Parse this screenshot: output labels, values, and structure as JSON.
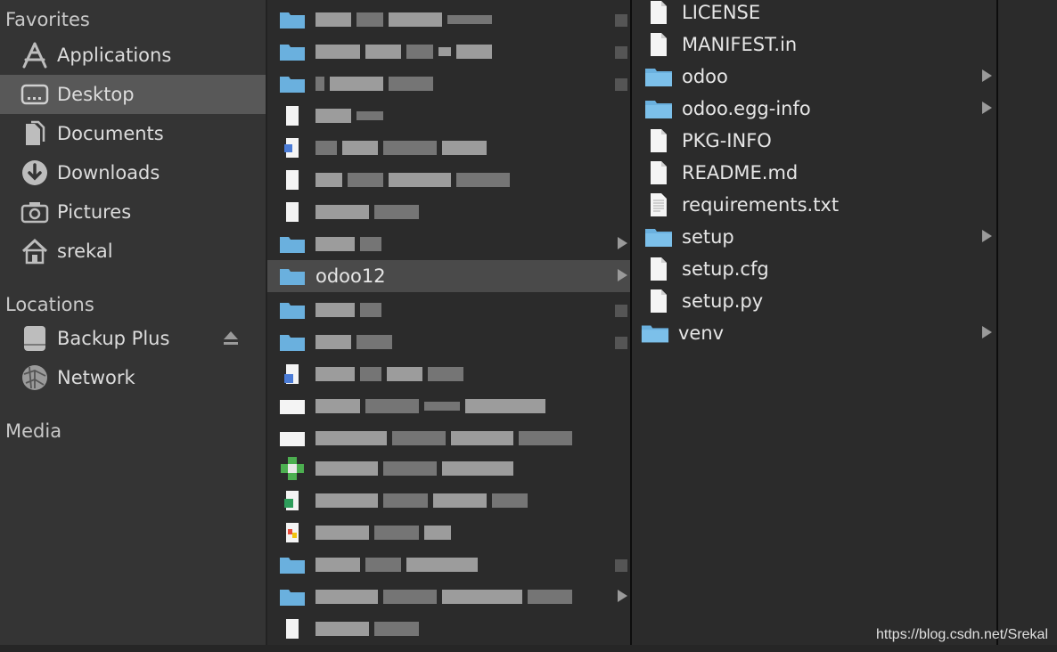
{
  "sidebar": {
    "favorites_title": "Favorites",
    "locations_title": "Locations",
    "media_title": "Media",
    "favorites": [
      {
        "label": "Applications",
        "icon": "applications-icon"
      },
      {
        "label": "Desktop",
        "icon": "desktop-icon"
      },
      {
        "label": "Documents",
        "icon": "documents-icon"
      },
      {
        "label": "Downloads",
        "icon": "downloads-icon"
      },
      {
        "label": "Pictures",
        "icon": "pictures-icon"
      },
      {
        "label": "srekal",
        "icon": "home-icon"
      }
    ],
    "locations": [
      {
        "label": "Backup Plus",
        "icon": "drive-icon"
      },
      {
        "label": "Network",
        "icon": "network-icon"
      }
    ]
  },
  "column2": {
    "selected_item": "odoo12"
  },
  "column3": {
    "items": [
      {
        "name": "LICENSE",
        "type": "file"
      },
      {
        "name": "MANIFEST.in",
        "type": "file"
      },
      {
        "name": "odoo",
        "type": "folder"
      },
      {
        "name": "odoo.egg-info",
        "type": "folder"
      },
      {
        "name": "PKG-INFO",
        "type": "file"
      },
      {
        "name": "README.md",
        "type": "file"
      },
      {
        "name": "requirements.txt",
        "type": "textfile"
      },
      {
        "name": "setup",
        "type": "folder"
      },
      {
        "name": "setup.cfg",
        "type": "file"
      },
      {
        "name": "setup.py",
        "type": "file"
      },
      {
        "name": "venv",
        "type": "folder"
      }
    ]
  },
  "watermark": "https://blog.csdn.net/Srekal",
  "colors": {
    "sidebar_bg": "#343434",
    "selected_bg": "#585858",
    "column_bg": "#2b2b2b",
    "folder_blue": "#6ab0de"
  }
}
